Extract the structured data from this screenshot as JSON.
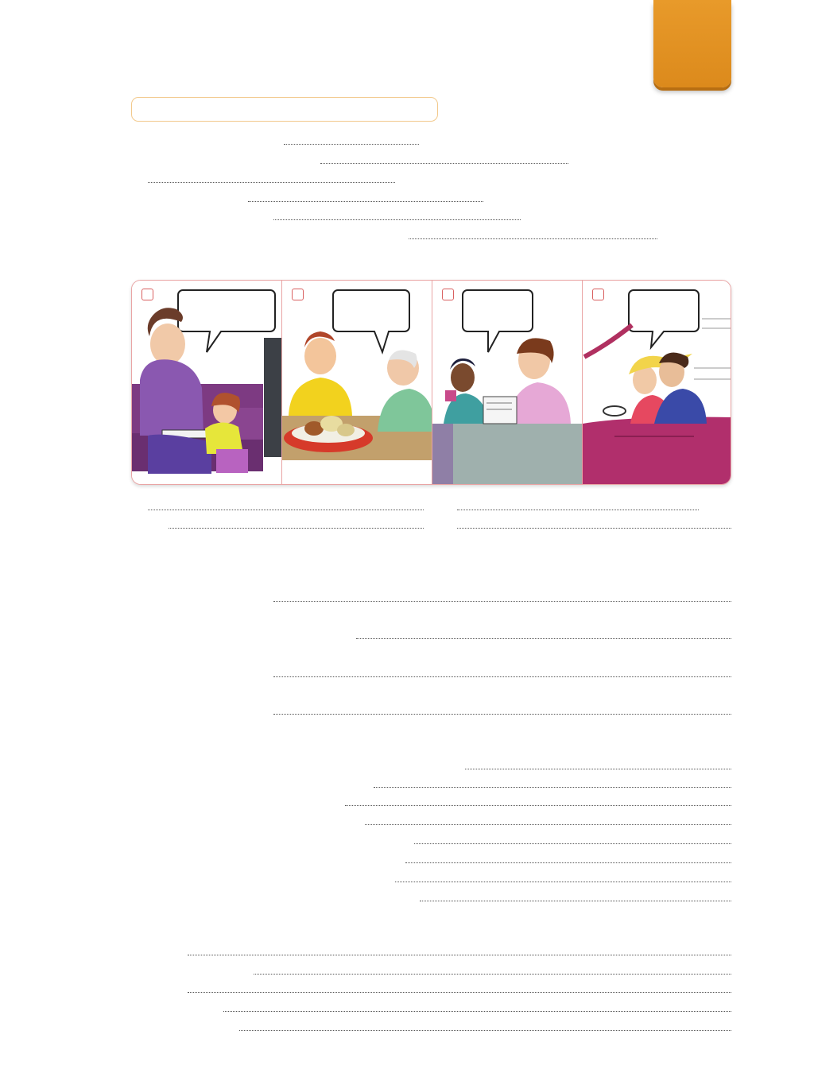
{
  "page": {
    "section_tab": "",
    "title_box": ""
  },
  "panels": [
    {
      "id": 1,
      "speech": ""
    },
    {
      "id": 2,
      "speech": ""
    },
    {
      "id": 3,
      "speech": ""
    },
    {
      "id": 4,
      "speech": ""
    }
  ],
  "colors": {
    "tab_orange": "#e0901f",
    "panel_border": "#e9a4a4",
    "checkbox_border": "#d96060",
    "title_box_border": "#f2c98c"
  }
}
